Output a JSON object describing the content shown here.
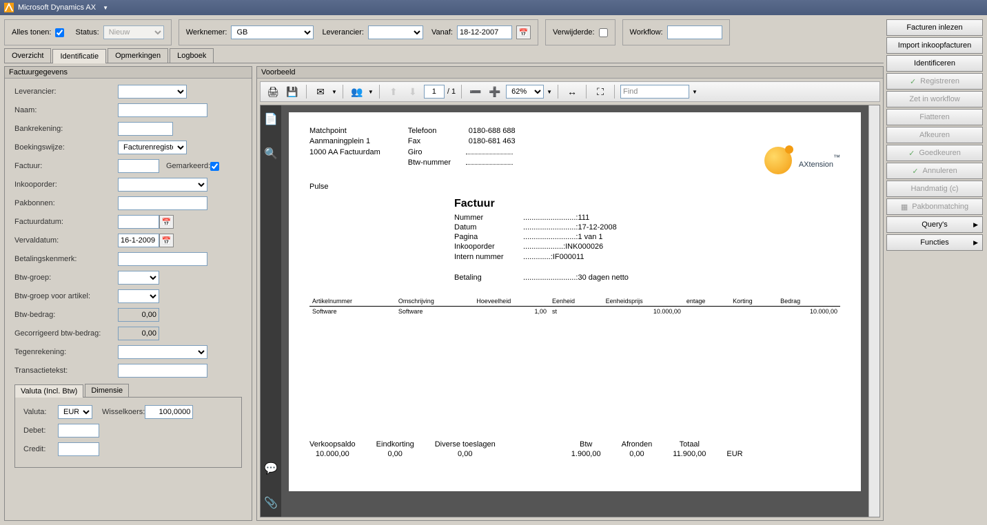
{
  "titlebar": {
    "app": "Microsoft Dynamics AX"
  },
  "filters": {
    "alles_tonen_label": "Alles tonen:",
    "status_label": "Status:",
    "status_value": "Nieuw",
    "werknemer_label": "Werknemer:",
    "werknemer_value": "GB",
    "leverancier_label": "Leverancier:",
    "vanaf_label": "Vanaf:",
    "vanaf_value": "18-12-2007",
    "verwijderde_label": "Verwijderde:",
    "workflow_label": "Workflow:"
  },
  "tabs": {
    "overzicht": "Overzicht",
    "identificatie": "Identificatie",
    "opmerkingen": "Opmerkingen",
    "logboek": "Logboek"
  },
  "form": {
    "header": "Factuurgegevens",
    "leverancier": "Leverancier:",
    "naam": "Naam:",
    "bankrekening": "Bankrekening:",
    "boekingswijze": "Boekingswijze:",
    "boekingswijze_value": "Facturenregister",
    "factuur": "Factuur:",
    "gemarkeerd": "Gemarkeerd:",
    "inkooporder": "Inkooporder:",
    "pakbonnen": "Pakbonnen:",
    "factuurdatum": "Factuurdatum:",
    "vervaldatum": "Vervaldatum:",
    "vervaldatum_value": "16-1-2009",
    "betalingskenmerk": "Betalingskenmerk:",
    "btwgroep": "Btw-groep:",
    "btwgroep_artikel": "Btw-groep voor artikel:",
    "btwbedrag": "Btw-bedrag:",
    "btwbedrag_value": "0,00",
    "gecorr_btw": "Gecorrigeerd btw-bedrag:",
    "gecorr_btw_value": "0,00",
    "tegenrekening": "Tegenrekening:",
    "transactietekst": "Transactietekst:"
  },
  "subtabs": {
    "valuta": "Valuta (Incl. Btw)",
    "dimensie": "Dimensie"
  },
  "valuta_panel": {
    "valuta_label": "Valuta:",
    "valuta_value": "EUR",
    "wisselkoers_label": "Wisselkoers:",
    "wisselkoers_value": "100,0000",
    "debet_label": "Debet:",
    "credit_label": "Credit:"
  },
  "preview": {
    "header": "Voorbeeld",
    "page_current": "1",
    "page_total": "/  1",
    "zoom": "62%",
    "find_placeholder": "Find"
  },
  "actions": {
    "facturen_inlezen": "Facturen inlezen",
    "import_inkoop": "Import inkoopfacturen",
    "identificeren": "Identificeren",
    "registreren": "Registreren",
    "zet_workflow": "Zet in workflow",
    "fiatteren": "Fiatteren",
    "afkeuren": "Afkeuren",
    "goedkeuren": "Goedkeuren",
    "annuleren": "Annuleren",
    "handmatig": "Handmatig (c)",
    "pakbonmatching": "Pakbonmatching",
    "querys": "Query's",
    "functies": "Functies"
  },
  "doc": {
    "company_name": "Matchpoint",
    "company_street": "Aanmaningplein 1",
    "company_city": "1000 AA Factuurdam",
    "pulse": "Pulse",
    "telefoon_lbl": "Telefoon",
    "telefoon": "0180-688 688",
    "fax_lbl": "Fax",
    "fax": "0180-681 463",
    "giro_lbl": "Giro",
    "btwnr_lbl": "Btw-nummer",
    "title": "Factuur",
    "nummer_lbl": "Nummer",
    "nummer": "111",
    "datum_lbl": "Datum",
    "datum": "17-12-2008",
    "pagina_lbl": "Pagina",
    "pagina": "1   van  1",
    "inkooporder_lbl": "Inkooporder",
    "inkooporder": "INK000026",
    "intern_lbl": "Intern nummer",
    "intern": "IF000011",
    "betaling_lbl": "Betaling",
    "betaling": "30 dagen netto",
    "col_artikel": "Artikelnummer",
    "col_omsch": "Omschrijving",
    "col_hoev": "Hoeveelheid",
    "col_eenheid": "Eenheid",
    "col_eenheidsprijs": "Eenheidsprijs",
    "col_entage": "entage",
    "col_korting": "Korting",
    "col_bedrag": "Bedrag",
    "row_artikel": "Software",
    "row_omsch": "Software",
    "row_hoev": "1,00",
    "row_eenheid": "st",
    "row_prijs": "10.000,00",
    "row_bedrag": "10.000,00",
    "tot_verkoop_h": "Verkoopsaldo",
    "tot_verkoop": "10.000,00",
    "tot_eindk_h": "Eindkorting",
    "tot_eindk": "0,00",
    "tot_toesl_h": "Diverse toeslagen",
    "tot_toesl": "0,00",
    "tot_btw_h": "Btw",
    "tot_btw": "1.900,00",
    "tot_afr_h": "Afronden",
    "tot_afr": "0,00",
    "tot_totaal_h": "Totaal",
    "tot_totaal": "11.900,00",
    "tot_cur": "EUR",
    "logo_text": "AXtension",
    "logo_tm": "™"
  }
}
